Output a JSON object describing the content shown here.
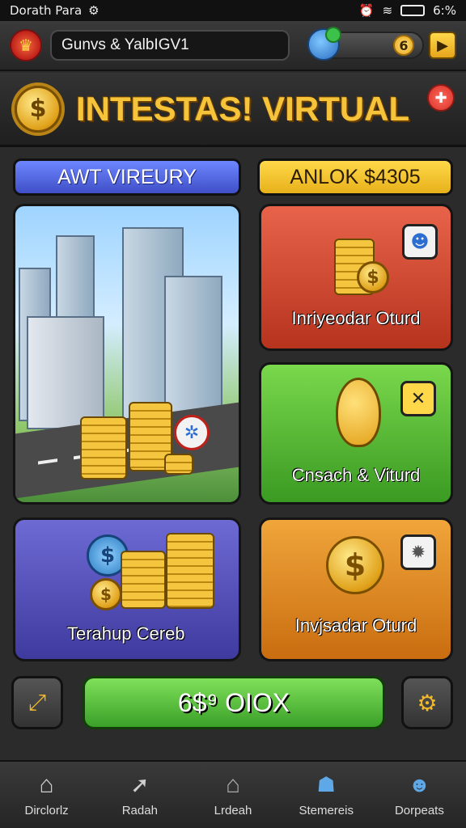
{
  "status_bar": {
    "carrier": "Dorath Para",
    "battery": "6:%"
  },
  "top_bar": {
    "player_name": "Gunvs & YalbIGV1",
    "currency_value": "6"
  },
  "header": {
    "title": "INTESTAS! VIRTUAL"
  },
  "tabs": {
    "left": "AWT VIREURY",
    "right": "ANLOK $4305"
  },
  "panels": {
    "red": {
      "label": "Inriyeodar Oturd"
    },
    "green": {
      "label": "Cnsach & Viturd"
    },
    "blue": {
      "label": "Terahup Cereb"
    },
    "orange": {
      "label": "Invjsadar Oturd"
    }
  },
  "action_button": {
    "label": "6$⁹ OIOX"
  },
  "bottom_nav": {
    "items": [
      {
        "label": "Dirclorlz"
      },
      {
        "label": "Radah"
      },
      {
        "label": "Lrdeah"
      },
      {
        "label": "Stemereis"
      },
      {
        "label": "Dorpeats"
      }
    ]
  },
  "colors": {
    "gold": "#f6c43a",
    "green": "#3aa028",
    "blue": "#3f4fc7",
    "red": "#b6331e"
  },
  "icons": [
    "shield-icon",
    "wallet-icon",
    "arrow-right-icon",
    "close-icon",
    "dollar-coin-icon",
    "gear-icon",
    "expand-icon",
    "home-icon",
    "navigate-icon",
    "user-icon"
  ]
}
